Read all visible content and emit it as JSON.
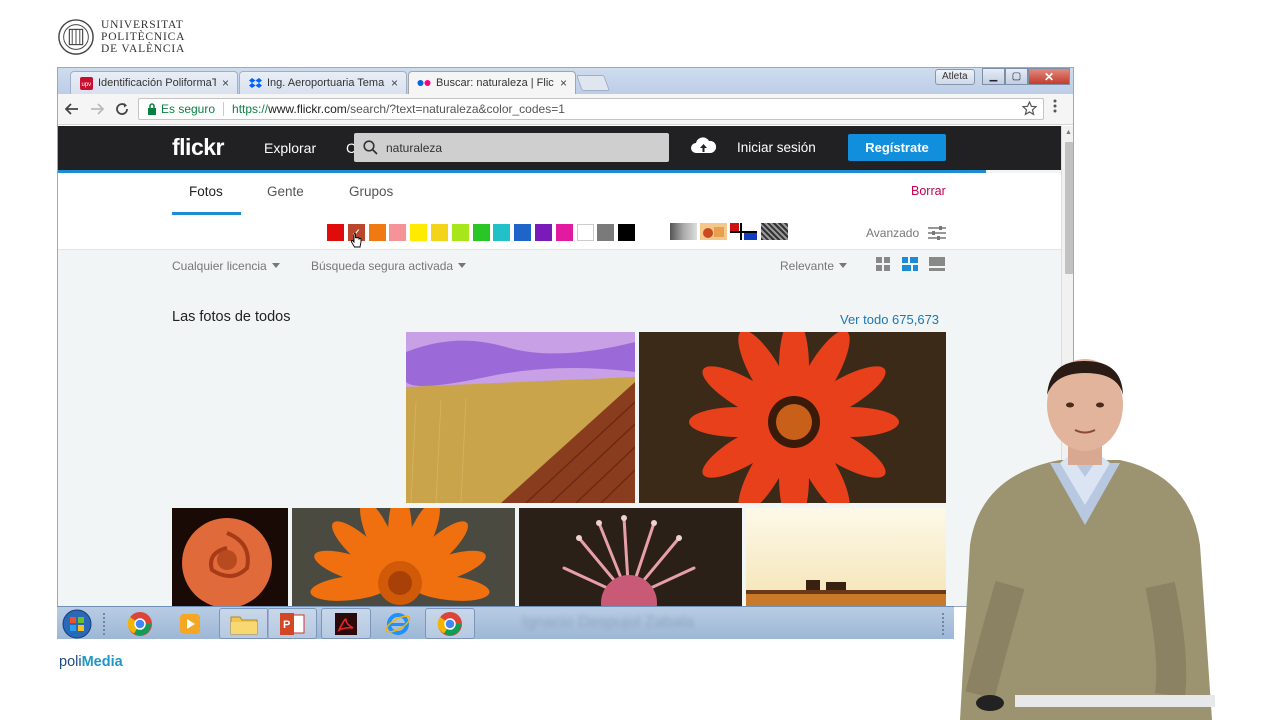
{
  "university": {
    "line1": "UNIVERSITAT",
    "line2": "POLITÈCNICA",
    "line3": "DE VALÈNCIA"
  },
  "browser": {
    "tabs": [
      {
        "label": "Identificación PoliformaT",
        "favicon": "upv-icon"
      },
      {
        "label": "Ing. Aeroportuaria Tema",
        "favicon": "dropbox-icon"
      },
      {
        "label": "Buscar: naturaleza | Flickr",
        "favicon": "flickr-icon"
      }
    ],
    "tab_close": "×",
    "user_chip": "Atleta",
    "secure_label": "Es seguro",
    "url_scheme": "https://",
    "url_host": "www.flickr.com",
    "url_path": "/search/?text=naturaleza&color_codes=1"
  },
  "flickr": {
    "logo": "flickr",
    "explore": "Explorar",
    "hidden_menu": "Cr",
    "search_value": "naturaleza",
    "login": "Iniciar sesión",
    "signup": "Regístrate",
    "tabs": [
      "Fotos",
      "Gente",
      "Grupos"
    ],
    "clear": "Borrar",
    "advanced": "Avanzado",
    "license_filter": "Cualquier licencia",
    "safe_filter": "Búsqueda segura activada",
    "sort": "Relevante",
    "section_title": "Las fotos de todos",
    "see_all": "Ver todo 675,673",
    "selected_color": "#b8472b",
    "checkmark": "✓",
    "colors": [
      "#e00b0b",
      "#b8472b",
      "#f07a11",
      "#f69399",
      "#ffea00",
      "#f4d41a",
      "#a8e61c",
      "#29c625",
      "#22c0c8",
      "#1f64c8",
      "#7a1ab8",
      "#e11aa0",
      "#ffffff",
      "#7a7a7a",
      "#000000"
    ]
  },
  "presenter_name": "Ignacio Despujol Zabala",
  "brand": {
    "poli": "poli",
    "media": "Media"
  }
}
